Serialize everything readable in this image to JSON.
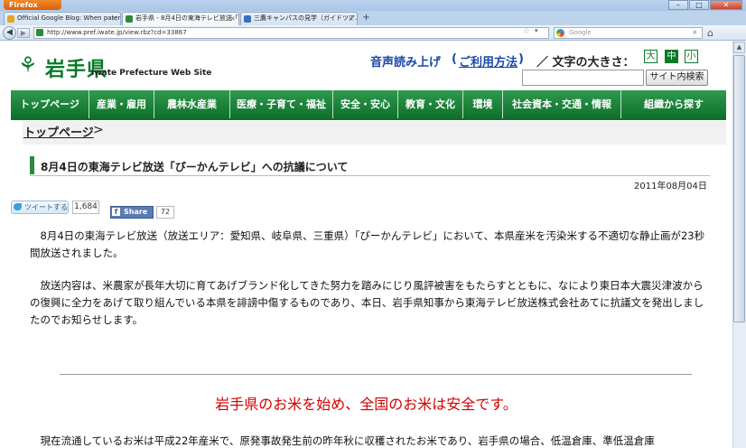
{
  "browser": {
    "app_button": "Firefox",
    "tabs": [
      {
        "title": "Official Google Blog: When paten...",
        "active": false
      },
      {
        "title": "岩手県 - 8月4日の東海テレビ放送「...",
        "active": true
      },
      {
        "title": "三鷹キャンパスの見学（ガイドツア...",
        "active": false
      }
    ],
    "new_tab": "+",
    "url": "http://www.pref.iwate.jp/view.rbz?cd=33867",
    "search_placeholder": "Google"
  },
  "site": {
    "logo": "岩手県",
    "logo_mark": "⚘",
    "logo_sub": "Iwate Prefecture Web Site",
    "voice_link": "音声読み上げ",
    "voice_usage": "ご利用方法",
    "paren_open": "(",
    "paren_close": ")",
    "font_size_label": "／ 文字の大きさ：",
    "font_sizes": [
      "大",
      "中",
      "小"
    ],
    "search_button": "サイト内検索",
    "nav": [
      "トップページ",
      "産業・雇用",
      "農林水産業",
      "医療・子育て・福祉",
      "安全・安心",
      "教育・文化",
      "環境",
      "社会資本・交通・情報",
      "組織から探す"
    ],
    "breadcrumb": "トップページ",
    "breadcrumb_sep": ">"
  },
  "article": {
    "title": "8月4日の東海テレビ放送「ぴーかんテレビ」への抗議について",
    "date": "2011年08月04日",
    "tweet_label": "ツイートする",
    "tweet_count": "1,684",
    "fb_label": "Share",
    "fb_f": "f",
    "fb_count": "72",
    "para1": "　8月4日の東海テレビ放送（放送エリア：愛知県、岐阜県、三重県）「ぴーかんテレビ」において、本県産米を汚染米する不適切な静止画が23秒間放送されました。",
    "para2": "　放送内容は、米農家が長年大切に育てあげブランド化してきた努力を踏みにじり風評被害をもたらすとともに、なにより東日本大震災津波からの復興に全力をあげて取り組んでいる本県を誹謗中傷するものであり、本日、岩手県知事から東海テレビ放送株式会社あてに抗議文を発出しましたのでお知らせします。",
    "safe_message": "岩手県のお米を始め、全国のお米は安全です。",
    "para3": "　現在流通しているお米は平成22年産米で、原発事故発生前の昨年秋に収穫されたお米であり、岩手県の場合、低温倉庫、準低温倉庫"
  }
}
